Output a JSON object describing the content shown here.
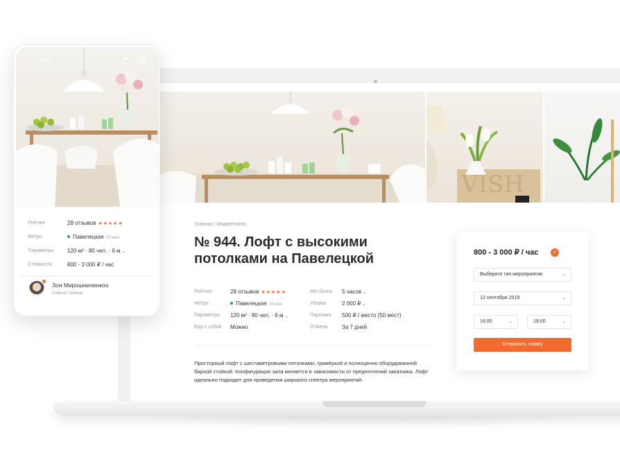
{
  "phone": {
    "back_count": "273",
    "rows": [
      {
        "label": "Рейтинг",
        "value": "28 отзывов",
        "stars": "★★★★★"
      },
      {
        "label": "Метро",
        "value": "Павелецкая",
        "note": "15 мин."
      },
      {
        "label": "Параметры",
        "value": "120 м² · 80 чел. · 6 м",
        "chevron": "⌄"
      },
      {
        "label": "Стоимость",
        "value": "800 - 3 000 ₽ / час"
      }
    ],
    "host": {
      "name": "Зоя Мирошниченкоо",
      "status": "ответит сейчас"
    }
  },
  "listing": {
    "breadcrumb": "Главная / Маркетплейс",
    "title": "№ 944. Лофт с высокими потолками на Павелецкой",
    "params": [
      {
        "label": "Рейтинг",
        "value": "28 отзывов",
        "stars": "★★★★★",
        "label2": "Min бронь",
        "value2": "5 часов"
      },
      {
        "label": "Метро",
        "value": "Павелецкая",
        "note": "15 мин.",
        "label2": "Уборка",
        "value2": "2 000 ₽"
      },
      {
        "label": "Параметры",
        "value": "120 м² · 80 чел. · 6 м",
        "label2": "Парковка",
        "value2": "500 ₽ / место (50 мест)"
      },
      {
        "label": "Еда с собой",
        "value": "Можно",
        "label2": "Отмена",
        "value2": "За 7 дней"
      }
    ],
    "description": "Просторный лофт с шестиметровыми потолками, гримёркой и полноценно оборудованной барной стойкой. Конфигурация зала меняется в зависимости от предпочтений заказчика. Лофт идеально подходит для проведения широкого спектра мероприятий."
  },
  "booking": {
    "price": "800 - 3 000 ₽ / час",
    "event_type": "Выберите тип мероприятия",
    "date": "12 сентября 2019",
    "time_from": "16:00",
    "time_to": "19:00",
    "submit": "Отправить заявку",
    "chevron": "⌄",
    "check": "✓"
  },
  "colors": {
    "accent": "#f26a2e",
    "metro": "#27a04b"
  }
}
